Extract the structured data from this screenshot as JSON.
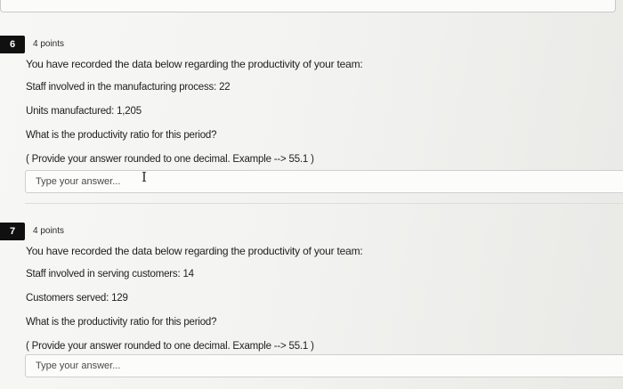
{
  "questions": [
    {
      "number": "6",
      "points": "4 points",
      "intro": "You have recorded the data below regarding the productivity of your team:",
      "lines": [
        "Staff involved in the manufacturing process: 22",
        "Units manufactured: 1,205",
        "What is the productivity ratio for this period?",
        "( Provide your answer rounded to one decimal. Example --> 55.1 )"
      ],
      "answer_placeholder": "Type your answer...",
      "answer_value": ""
    },
    {
      "number": "7",
      "points": "4 points",
      "intro": "You have recorded the data below regarding the productivity of your team:",
      "lines": [
        "Staff involved in serving customers: 14",
        "Customers served: 129",
        "What is the productivity ratio for this period?",
        "( Provide your answer rounded to one decimal. Example --> 55.1 )"
      ],
      "answer_placeholder": "Type your answer...",
      "answer_value": ""
    }
  ],
  "icons": {
    "text_cursor": "text-cursor-icon"
  }
}
